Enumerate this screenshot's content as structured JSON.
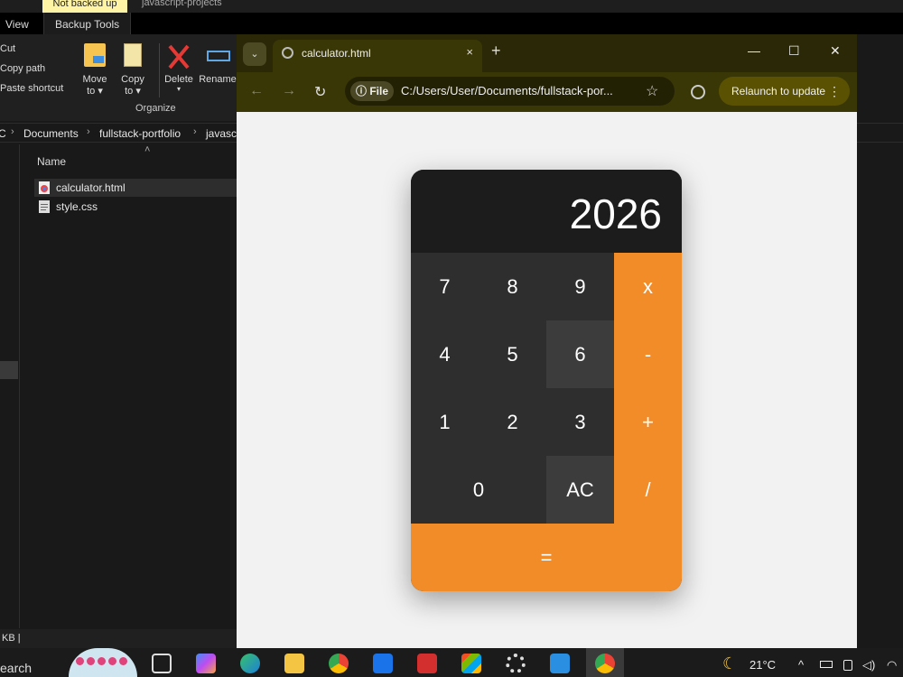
{
  "explorer": {
    "not_backed_up": "Not backed up",
    "top_path": "javascript-projects",
    "tabs": {
      "view": "View",
      "backup_tools": "Backup Tools"
    },
    "ribbon": {
      "cut": "Cut",
      "copy_path": "Copy path",
      "paste_shortcut": "Paste shortcut",
      "move_to": [
        "Move",
        "to ▾"
      ],
      "copy_to": [
        "Copy",
        "to ▾"
      ],
      "delete": [
        "Delete",
        "▾"
      ],
      "rename": "Rename",
      "organize": "Organize"
    },
    "breadcrumb": [
      "C",
      "Documents",
      "fullstack-portfolio",
      "javascri"
    ],
    "column_name": "Name",
    "files": [
      "calculator.html",
      "style.css"
    ],
    "status": "KB |"
  },
  "chrome": {
    "tab_title": "calculator.html",
    "tab_close": "×",
    "new_tab": "+",
    "window": {
      "minimize": "—",
      "maximize": "☐",
      "close": "✕"
    },
    "nav": {
      "back": "←",
      "forward": "→",
      "reload": "↻"
    },
    "info_label": "ⓘ File",
    "url": "C:/Users/User/Documents/fullstack-por...",
    "star": "☆",
    "relaunch": "Relaunch to update",
    "menu_dots": "⋮"
  },
  "calculator": {
    "display": "2026",
    "keys": {
      "k7": "7",
      "k8": "8",
      "k9": "9",
      "times": "x",
      "k4": "4",
      "k5": "5",
      "k6": "6",
      "minus": "-",
      "k1": "1",
      "k2": "2",
      "k3": "3",
      "plus": "+",
      "k0": "0",
      "ac": "AC",
      "divide": "/",
      "equals": "="
    }
  },
  "taskbar": {
    "search": "earch",
    "temperature": "21°C",
    "tray_chevron": "^"
  },
  "colors": {
    "accent_orange": "#f28c28",
    "calc_body": "#2a2a2a",
    "chrome_frame": "#3a3706"
  }
}
